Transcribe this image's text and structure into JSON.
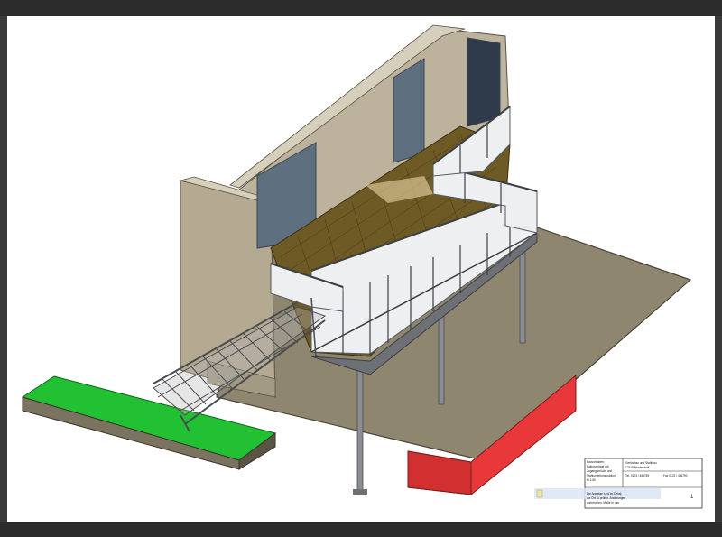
{
  "title_block": {
    "company": "Gerüstbau und Stahlbau",
    "address": "12345 Musterstadt",
    "phone": "Tel. 0123 / 456789",
    "fax": "Fax 0123 / 456790",
    "left_lines": [
      "Bauvorhaben:",
      "Balkonanlage mit",
      "Zugangsbrücke und",
      "Stahlunterkonstruktion",
      "M 1:50"
    ],
    "notes": [
      "Die Angaben sind im Detail",
      "vor Ort zu prüfen. Änderungen",
      "vorbehalten. Maße in mm"
    ],
    "sheet_number": "1"
  },
  "colors": {
    "wall": "#bdb39c",
    "window": "#5e6f80",
    "deck": "#6e5a24",
    "ground_slab": "#8f8670",
    "green_block": "#22c133",
    "red_block": "#e8383a",
    "railing": "#d8dadc"
  }
}
